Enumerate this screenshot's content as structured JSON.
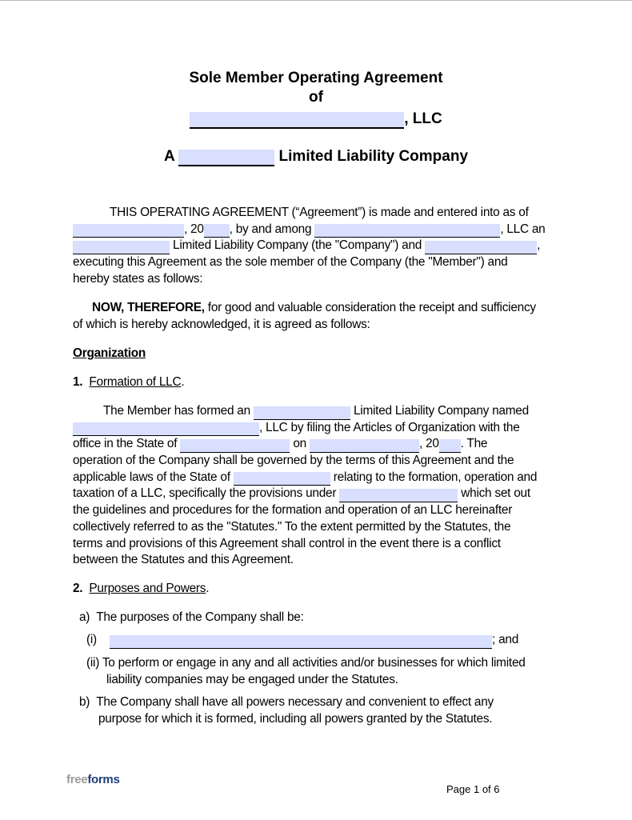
{
  "document": {
    "title_line1": "Sole Member Operating Agreement",
    "title_line2": "of",
    "title_llc_suffix": ", LLC",
    "subtitle_prefix": "A",
    "subtitle_suffix": "Limited Liability Company"
  },
  "intro": {
    "l1": "THIS OPERATING AGREEMENT (“Agreement”) is made and entered into as of",
    "l2_a": ", 20",
    "l2_b": ", by and among",
    "l2_c": ", LLC an",
    "l3_a": "Limited Liability Company (the \"Company\") and",
    "l3_b": ",",
    "l4": "executing this Agreement as the sole member of the Company (the \"Member\") and",
    "l5": "hereby states as follows:"
  },
  "now_therefore": {
    "bold": "NOW, THEREFORE,",
    "l1": " for good and valuable consideration the receipt and sufficiency",
    "l2": "of which is hereby acknowledged, it is agreed as follows:"
  },
  "section_heading": "Organization",
  "sections": [
    {
      "number": "1.",
      "title": "Formation of LLC",
      "title_end": ".",
      "l1_a": "The Member has formed an",
      "l1_b": "Limited Liability Company named",
      "l2": ", LLC by filing the Articles of Organization with the",
      "l3_a": "office in the State of",
      "l3_b": "on",
      "l3_c": ", 20",
      "l3_d": ". The",
      "l4": "operation of the Company shall be governed by the terms of this Agreement and the",
      "l5_a": "applicable laws of the State of",
      "l5_b": "relating to the formation, operation and",
      "l6_a": "taxation of a LLC, specifically the provisions under",
      "l6_b": "which set out",
      "l7": "the guidelines and procedures for the formation and operation of an LLC hereinafter",
      "l8": "collectively referred to as the \"Statutes.\" To the extent permitted by the Statutes, the",
      "l9": "terms and provisions of this Agreement shall control in the event there is a conflict",
      "l10": "between the Statutes and this Agreement."
    },
    {
      "number": "2.",
      "title": "Purposes and Powers",
      "title_end": ".",
      "a_label": "a)",
      "a_text": "The purposes of the Company shall be:",
      "i_label": "(i)",
      "i_suffix": "; and",
      "ii_label": "(ii)",
      "ii_l1": "To perform or engage in any and all activities and/or businesses for which limited",
      "ii_l2": "liability companies may be engaged under the Statutes.",
      "b_label": "b)",
      "b_l1": "The Company shall have all powers necessary and convenient to effect any",
      "b_l2": "purpose for which it is formed, including all powers granted by the Statutes."
    }
  ],
  "footer": {
    "logo_free": "free",
    "logo_forms": "forms",
    "page": "Page 1 of 6"
  },
  "colors": {
    "field_fill": "#d9dfff",
    "logo_gray": "#9a9a9a",
    "logo_blue": "#1f3e7a"
  }
}
